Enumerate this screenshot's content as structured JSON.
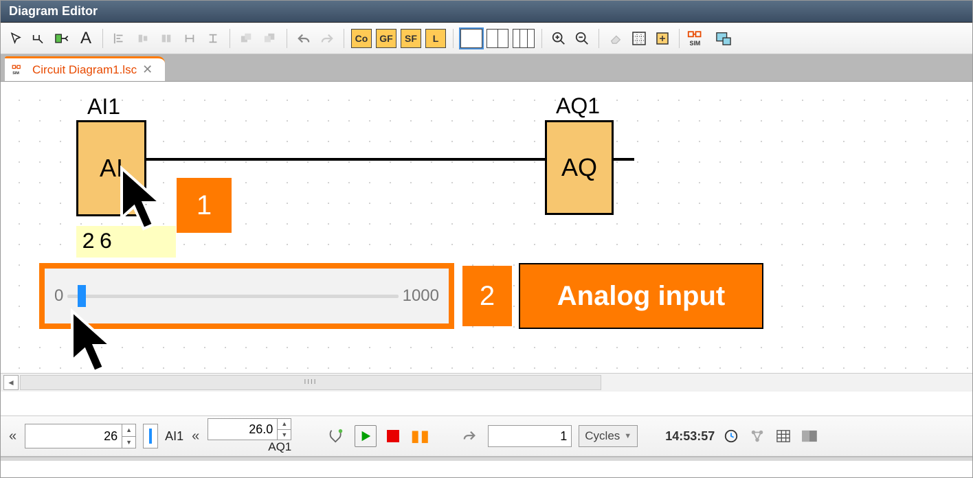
{
  "window": {
    "title": "Diagram Editor"
  },
  "toolbar": {
    "codes": [
      "Co",
      "GF",
      "SF",
      "L"
    ],
    "textLabel": "A"
  },
  "tab": {
    "label": "Circuit Diagram1.lsc",
    "close": "✕"
  },
  "canvas": {
    "ai": {
      "name": "AI1",
      "label": "AI",
      "value": "26"
    },
    "aq": {
      "name": "AQ1",
      "label": "AQ"
    },
    "slider": {
      "min": "0",
      "max": "1000",
      "percent": 3
    },
    "callouts": {
      "one": "1",
      "two": "2",
      "text": "Analog input"
    }
  },
  "sim": {
    "ai_name": "AI1",
    "ai_value": "26",
    "aq_name": "AQ1",
    "aq_value": "26.0",
    "cycles_value": "1",
    "cycles_label": "Cycles",
    "time": "14:53:57",
    "left_carets": "«",
    "mid_carets": "«"
  }
}
